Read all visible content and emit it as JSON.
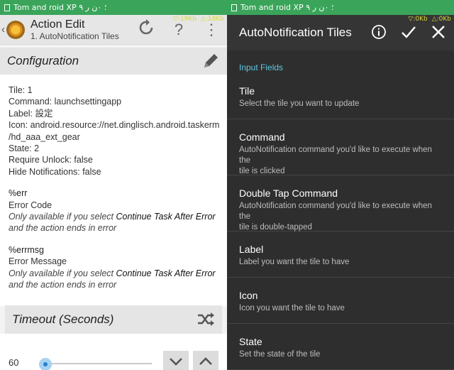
{
  "left": {
    "status_bar": {
      "text": "Tom and roid XP ۹ ؛ ٠ن ر"
    },
    "speeds": {
      "down": "▽:19Kb",
      "up": "△:18Kb"
    },
    "app_bar": {
      "back_glyph": "‹",
      "title": "Action Edit",
      "subtitle": "1. AutoNotification Tiles",
      "icons": [
        "refresh-icon",
        "help-icon",
        "overflow-menu-icon"
      ],
      "help_glyph": "?",
      "overflow_glyph": "⋮"
    },
    "configuration": {
      "title": "Configuration",
      "edit_icon": "pencil-icon",
      "lines": [
        "Tile: 1",
        "Command: launchsettingapp",
        "Label: 設定",
        "Icon: android.resource://net.dinglisch.android.taskerm",
        "/hd_aaa_ext_gear",
        "State: 2",
        "Require Unlock: false",
        "Hide Notifications: false"
      ]
    },
    "variables": [
      {
        "name": "%err",
        "desc": "Error Code",
        "note_pre": "Only available if you select ",
        "note_em": "Continue Task After Error",
        "note_post": "and the action ends in error"
      },
      {
        "name": "%errmsg",
        "desc": "Error Message",
        "note_pre": "Only available if you select ",
        "note_em": "Continue Task After Error",
        "note_post": "and the action ends in error"
      }
    ],
    "timeout": {
      "title": "Timeout (Seconds)",
      "icon": "shuffle-icon",
      "value": "60",
      "slider_fraction": 0.0,
      "decrement_icon": "chevron-down-icon",
      "increment_icon": "chevron-up-icon"
    }
  },
  "right": {
    "status_bar": {
      "text": "Tom and roid XP ۹ ؛ ٠ن ر"
    },
    "speeds": {
      "down": "▽:0Kb",
      "up": "△:0Kb"
    },
    "app_bar": {
      "title": "AutoNotification Tiles",
      "icons": [
        "info-icon",
        "check-icon",
        "close-icon"
      ]
    },
    "section": "Input Fields",
    "fields": [
      {
        "title": "Tile",
        "desc": [
          "Select the tile you want to update"
        ]
      },
      {
        "title": "Command",
        "desc": [
          "AutoNotification command you'd like to execute when the",
          "tile is clicked"
        ]
      },
      {
        "title": "Double Tap Command",
        "desc": [
          "AutoNotification command you'd like to execute when the",
          "tile is double-tapped"
        ]
      },
      {
        "title": "Label",
        "desc": [
          "Label you want the tile to have"
        ]
      },
      {
        "title": "Icon",
        "desc": [
          "Icon you want the tile to have"
        ]
      },
      {
        "title": "State",
        "desc": [
          "Set the state of the tile"
        ]
      }
    ]
  },
  "colors": {
    "status_green": "#3aa55a",
    "accent_blue": "#2b7fc9",
    "section_cyan": "#5fc7e0",
    "dark_bg": "#2e2e2e"
  }
}
